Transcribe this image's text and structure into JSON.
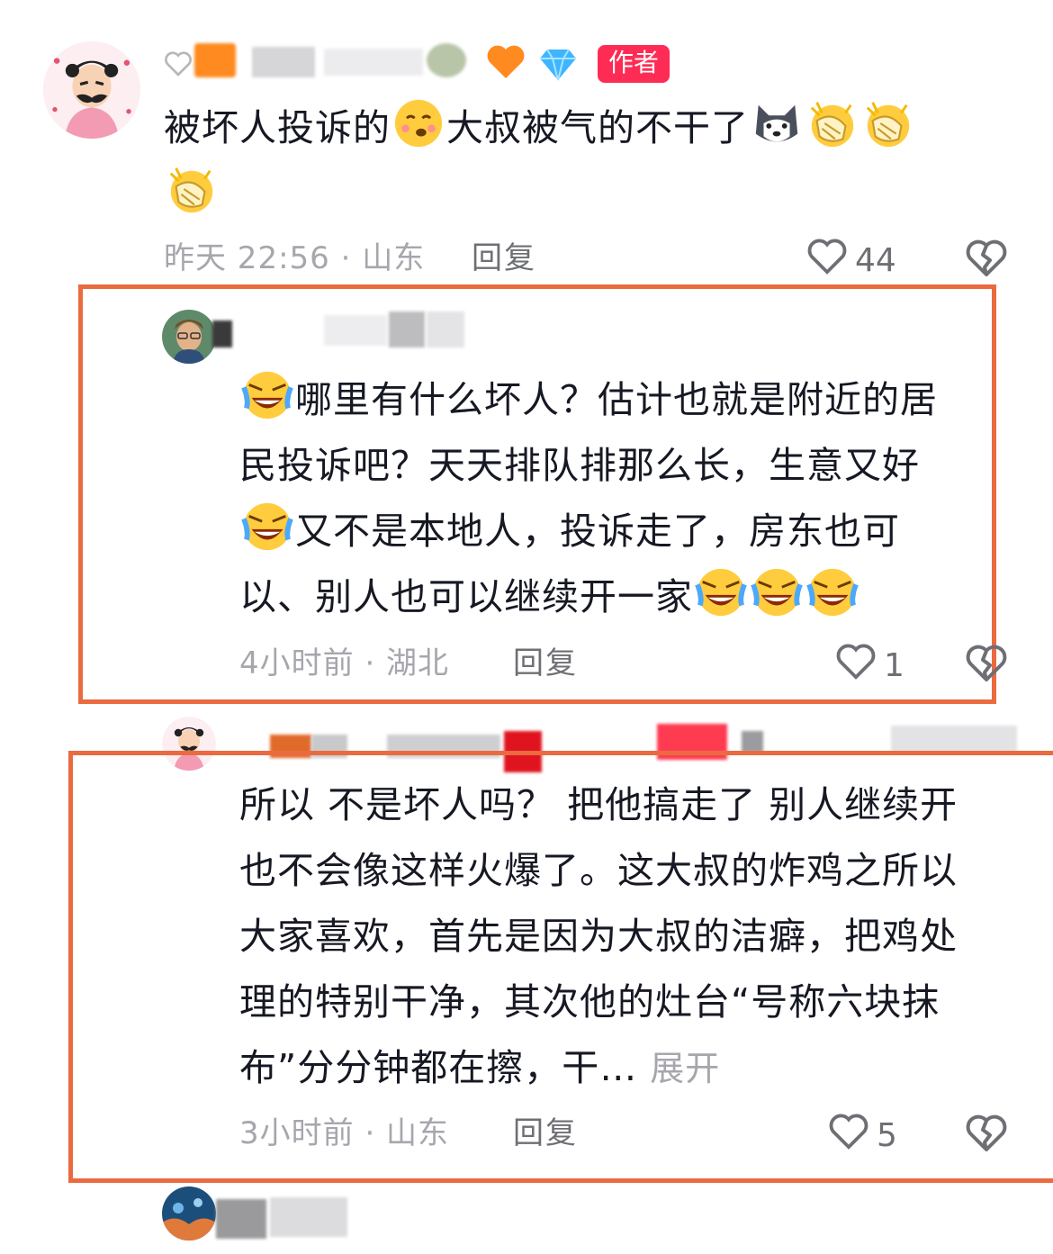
{
  "colors": {
    "accent_red": "#fe2c55",
    "frame_orange": "#ea6b40",
    "meta_gray": "#a6a6ad",
    "text_dark": "#161823"
  },
  "comments": [
    {
      "author_badge": "作者",
      "text_parts": [
        "被坏人投诉的",
        "大叔被气的不干了"
      ],
      "time_location": "昨天 22:56 · 山东",
      "reply_label": "回复",
      "likes": "44"
    },
    {
      "text_lines": [
        "哪里有什么坏人？估计也就是附近的居",
        "民投诉吧？天天排队排那么长，生意又好",
        "又不是本地人，投诉走了，房东也可",
        "以、别人也可以继续开一家"
      ],
      "time_location": "4小时前 · 湖北",
      "reply_label": "回复",
      "likes": "1"
    },
    {
      "text_lines": [
        "所以 不是坏人吗？ 把他搞走了 别人继续开",
        "也不会像这样火爆了。这大叔的炸鸡之所以",
        "大家喜欢，首先是因为大叔的洁癖，把鸡处",
        "理的特别干净，其次他的灶台“号称六块抹",
        "布”分分钟都在擦，干…"
      ],
      "expand_label": "展开",
      "time_location": "3小时前 · 山东",
      "reply_label": "回复",
      "likes": "5"
    }
  ]
}
